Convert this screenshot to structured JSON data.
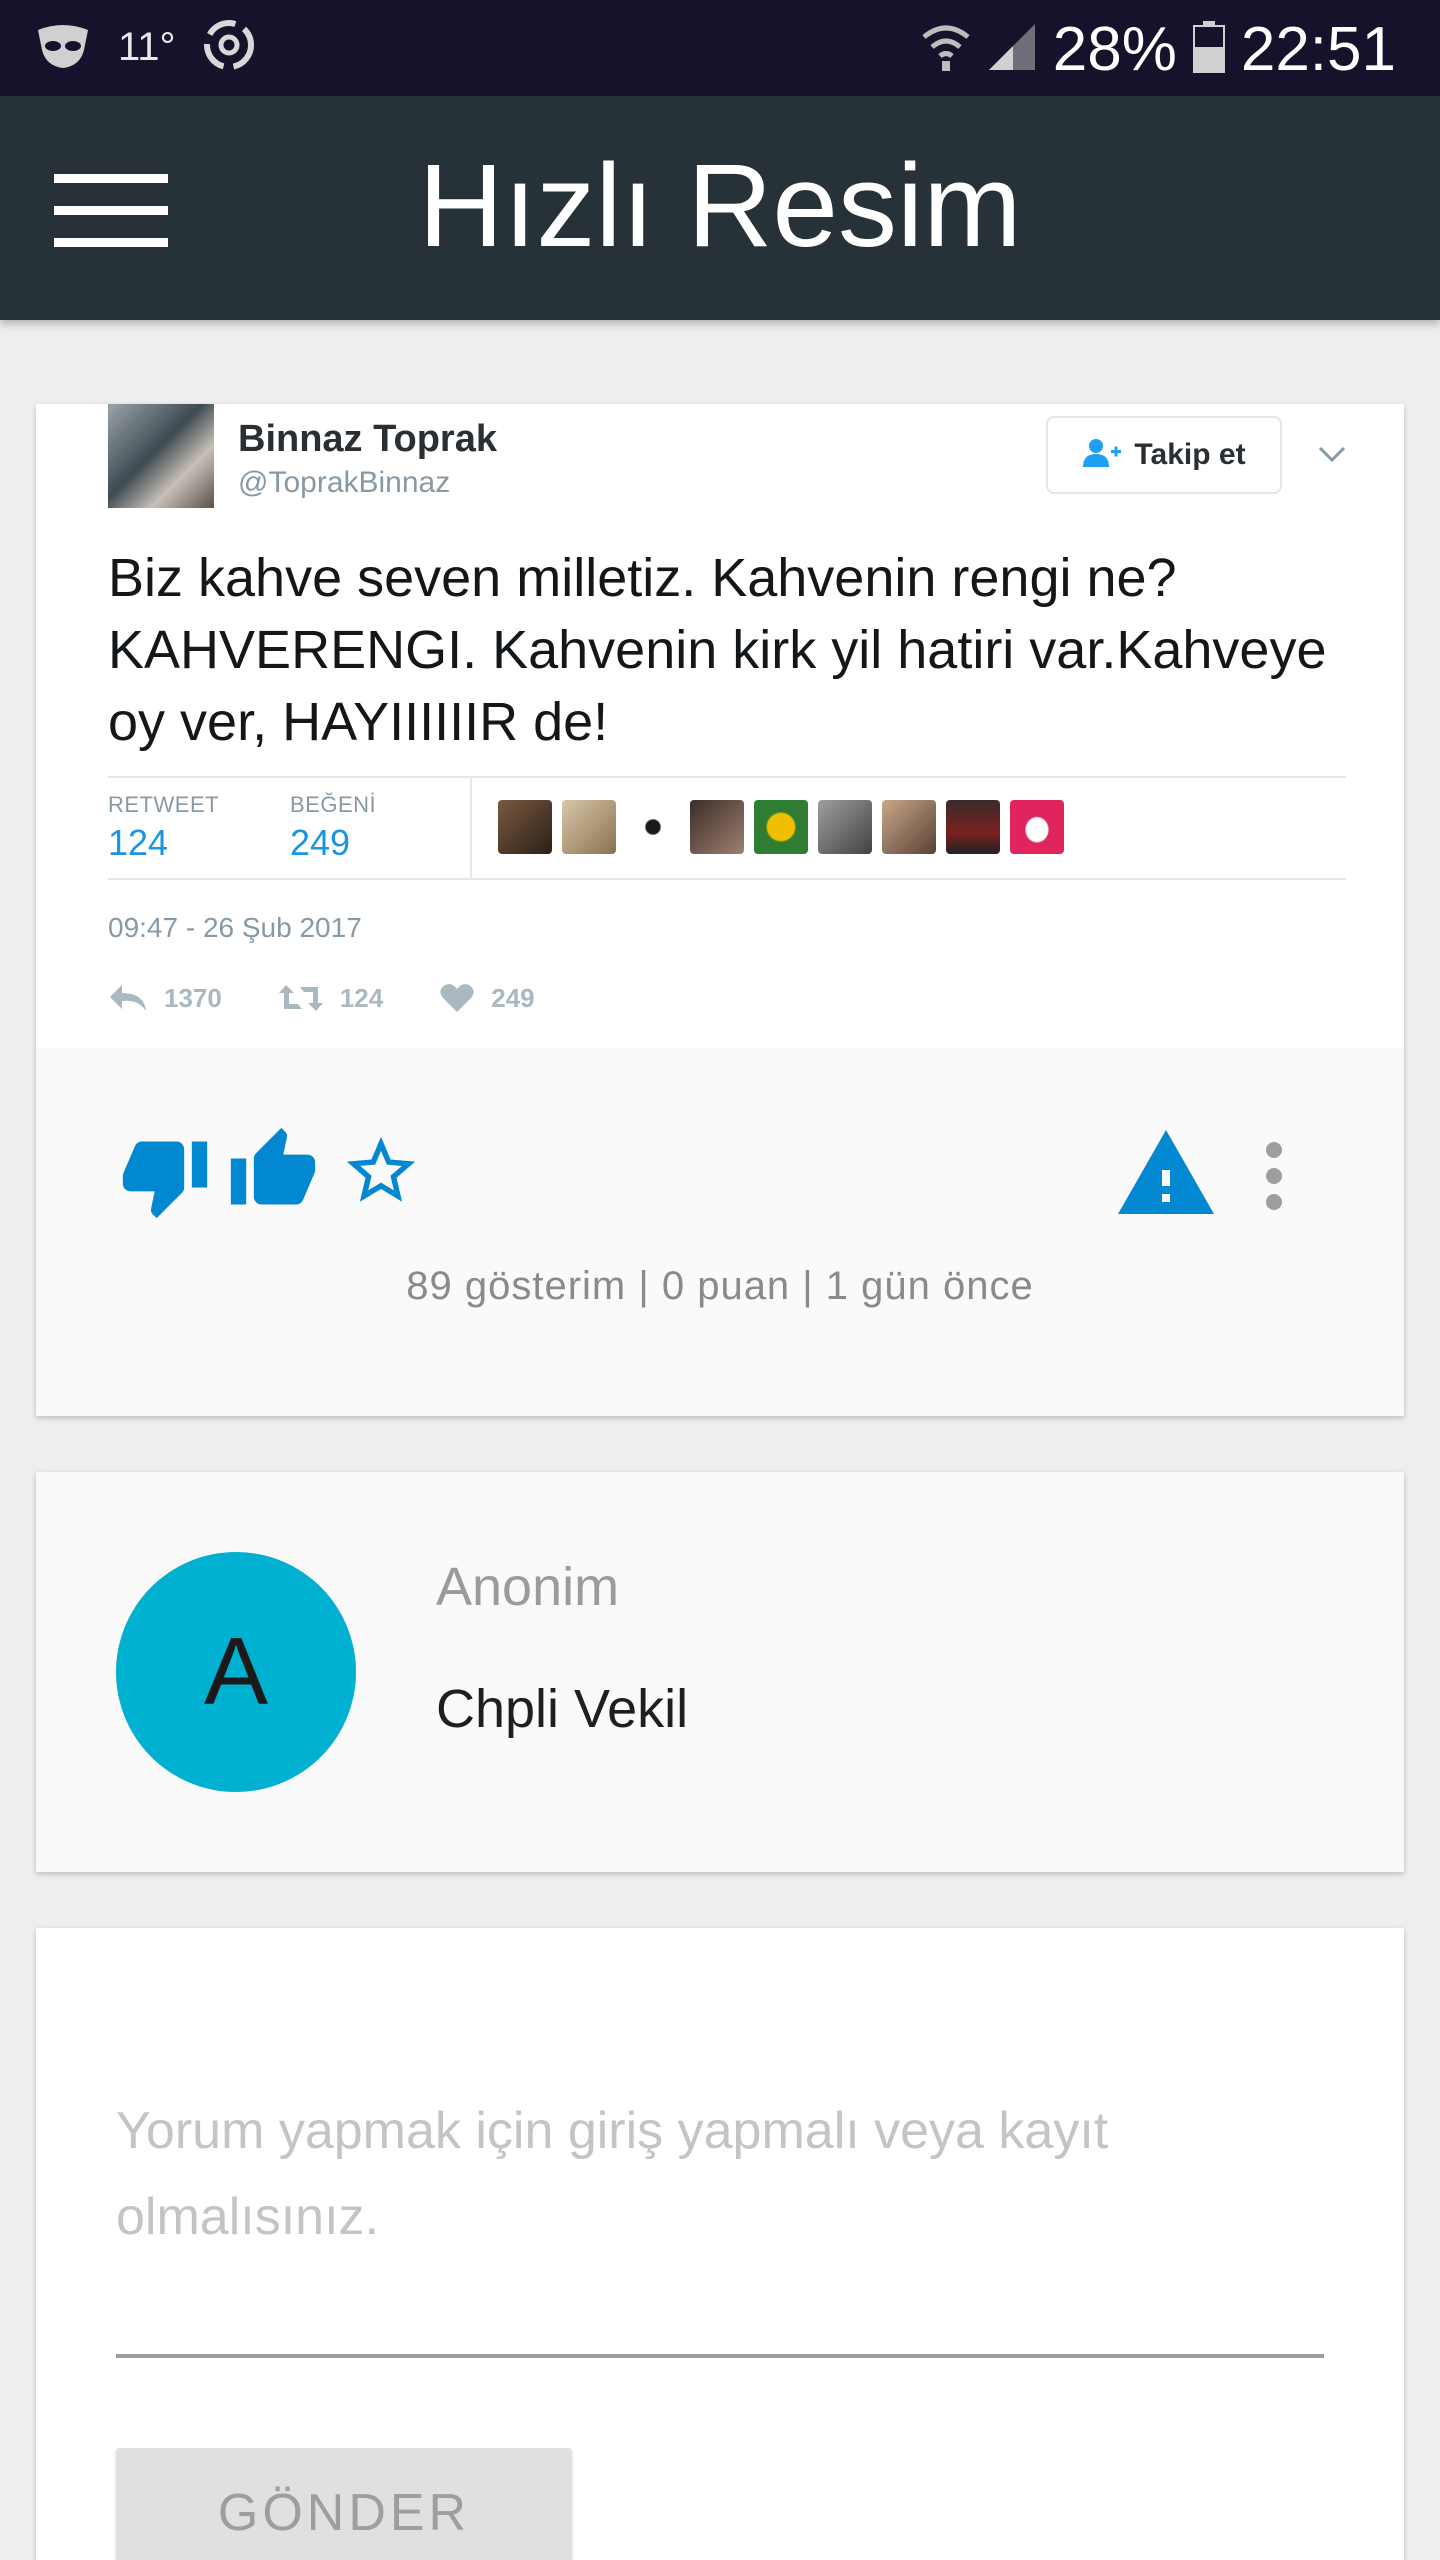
{
  "status_bar": {
    "temperature": "11°",
    "battery": "28%",
    "time": "22:51"
  },
  "app_bar": {
    "title": "Hızlı Resim"
  },
  "tweet": {
    "name": "Binnaz Toprak",
    "handle": "@ToprakBinnaz",
    "follow_label": "Takip et",
    "text": "Biz kahve seven milletiz. Kahvenin rengi ne? KAHVERENGI. Kahvenin kirk  yil hatiri var.Kahveye oy ver, HAYIIIIIIR de!",
    "retweet_label": "RETWEET",
    "retweet_count": "124",
    "like_label": "BEĞENİ",
    "like_count": "249",
    "date": "09:47 - 26 Şub 2017",
    "reply_count": "1370",
    "action_retweet_count": "124",
    "action_like_count": "249",
    "accent_color": "#1b95e0"
  },
  "post": {
    "meta": "89 gösterim | 0 puan | 1 gün önce",
    "icon_color": "#0288d1",
    "icons": [
      "thumbs-down-icon",
      "thumbs-up-icon",
      "star-outline-icon",
      "warning-icon",
      "more-vertical-icon"
    ]
  },
  "user": {
    "initial": "A",
    "name": "Anonim",
    "description": "Chpli Vekil",
    "avatar_color": "#00b0d0"
  },
  "comment": {
    "placeholder": "Yorum yapmak için giriş yapmalı veya kayıt olmalısınız.",
    "send_label": "GÖNDER"
  }
}
